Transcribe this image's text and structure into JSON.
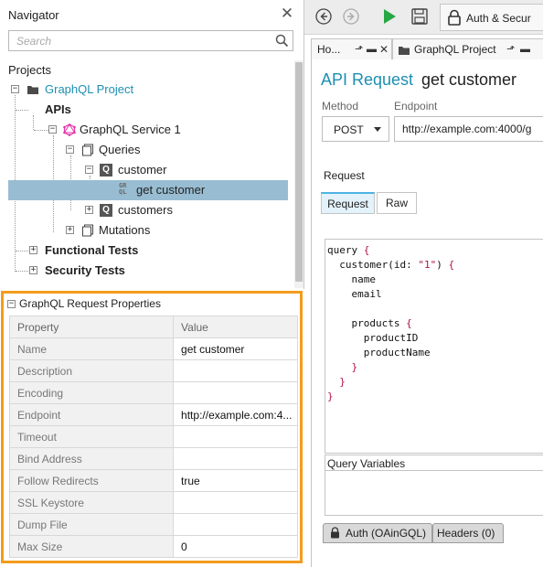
{
  "navigator": {
    "title": "Navigator",
    "search_placeholder": "Search",
    "projects_label": "Projects",
    "tree": [
      {
        "label": "GraphQL Project",
        "icon": "folder-icon"
      },
      {
        "label": "APIs"
      },
      {
        "label": "GraphQL Service 1",
        "icon": "graphql-icon"
      },
      {
        "label": "Queries",
        "icon": "pages-icon"
      },
      {
        "label": "customer",
        "icon": "query-q-icon",
        "badge": "Q"
      },
      {
        "label": "get customer",
        "icon": "graphql-request-icon",
        "badge": "GR QL",
        "selected": true
      },
      {
        "label": "customers",
        "icon": "query-q-icon",
        "badge": "Q"
      },
      {
        "label": "Mutations",
        "icon": "pages-icon"
      },
      {
        "label": "Functional Tests"
      },
      {
        "label": "Security Tests"
      }
    ]
  },
  "properties": {
    "title": "GraphQL Request Properties",
    "columns": [
      "Property",
      "Value"
    ],
    "rows": [
      {
        "name": "Name",
        "value": "get customer"
      },
      {
        "name": "Description",
        "value": ""
      },
      {
        "name": "Encoding",
        "value": ""
      },
      {
        "name": "Endpoint",
        "value": "http://example.com:4..."
      },
      {
        "name": "Timeout",
        "value": ""
      },
      {
        "name": "Bind Address",
        "value": ""
      },
      {
        "name": "Follow Redirects",
        "value": "true"
      },
      {
        "name": "SSL Keystore",
        "value": ""
      },
      {
        "name": "Dump File",
        "value": ""
      },
      {
        "name": "Max Size",
        "value": "0"
      }
    ]
  },
  "toolbar": {
    "auth_label": "Auth & Secur"
  },
  "tabs": [
    {
      "label": "Ho..."
    },
    {
      "label": "GraphQL Project"
    }
  ],
  "editor": {
    "heading_prefix": "API Request",
    "heading_name": "get customer",
    "method_label": "Method",
    "endpoint_label": "Endpoint",
    "method_value": "POST",
    "endpoint_value": "http://example.com:4000/g",
    "request_label": "Request",
    "subtabs": [
      "Request",
      "Raw"
    ],
    "query_lines": [
      [
        "query ",
        "{"
      ],
      [
        "  customer(id: ",
        "\"1\"",
        ") {"
      ],
      [
        "    name"
      ],
      [
        "    email"
      ],
      [
        ""
      ],
      [
        "    products ",
        "{"
      ],
      [
        "      productID"
      ],
      [
        "      productName"
      ],
      [
        "    ",
        "}"
      ],
      [
        "  ",
        "}"
      ],
      [
        "",
        "}"
      ]
    ],
    "query_variables_label": "Query Variables",
    "bottom_tabs": [
      "Auth (OAinGQL)",
      "Headers (0)"
    ]
  },
  "colors": {
    "accent_blue": "#1d8fb2",
    "selection": "#98bdd2",
    "highlight_frame": "#f39c1d",
    "run_green": "#27a844",
    "string_red": "#b0124e"
  }
}
